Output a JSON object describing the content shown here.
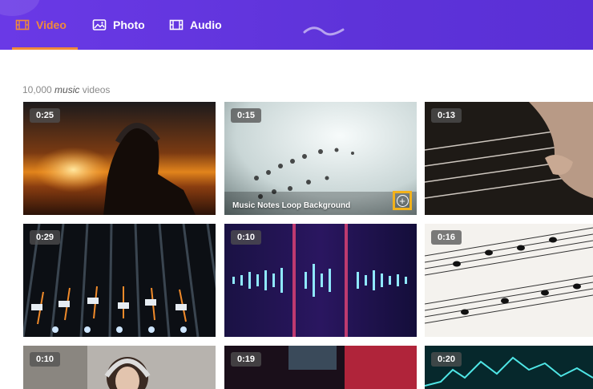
{
  "tabs": [
    {
      "label": "Video",
      "icon": "film-icon",
      "active": true
    },
    {
      "label": "Photo",
      "icon": "image-icon",
      "active": false
    },
    {
      "label": "Audio",
      "icon": "film-icon",
      "active": false
    }
  ],
  "results": {
    "count": "10,000",
    "query": "music",
    "suffix": "videos"
  },
  "videos": [
    {
      "duration": "0:25",
      "scene": "boy with headphones at sunset"
    },
    {
      "duration": "0:15",
      "title": "Music Notes Loop Background",
      "hovered": true
    },
    {
      "duration": "0:13",
      "scene": "hand playing guitar"
    },
    {
      "duration": "0:29",
      "scene": "mixing console"
    },
    {
      "duration": "0:10",
      "scene": "audio waveform"
    },
    {
      "duration": "0:16",
      "scene": "sheet music"
    },
    {
      "duration": "0:10",
      "scene": "woman with headphones"
    },
    {
      "duration": "0:19",
      "scene": "studio"
    },
    {
      "duration": "0:20",
      "scene": "cyan waveform"
    }
  ],
  "colors": {
    "accent": "#f08a3a",
    "header": "#5e33d9",
    "highlight": "#f2b21b"
  }
}
